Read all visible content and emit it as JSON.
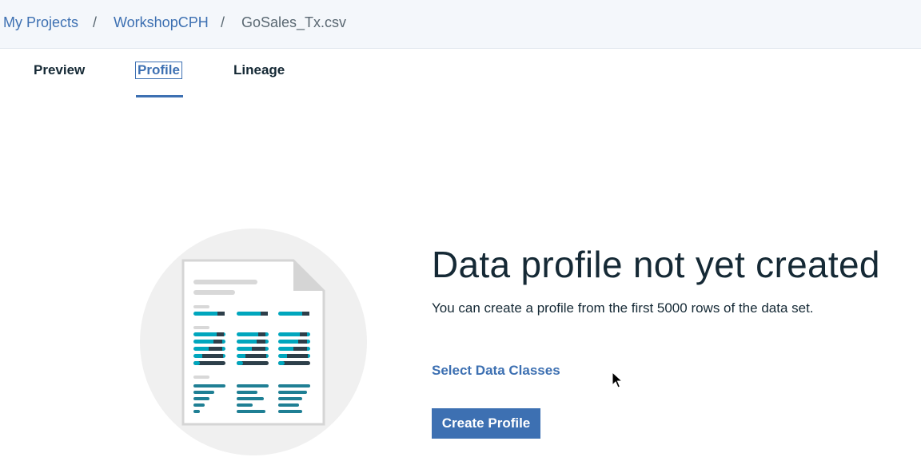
{
  "breadcrumb": {
    "items": [
      "My Projects",
      "WorkshopCPH",
      "GoSales_Tx.csv"
    ],
    "separator": "/"
  },
  "tabs": [
    {
      "label": "Preview",
      "active": false
    },
    {
      "label": "Profile",
      "active": true
    },
    {
      "label": "Lineage",
      "active": false
    }
  ],
  "empty_state": {
    "title": "Data profile not yet created",
    "description": "You can create a profile from the first 5000 rows of the data set.",
    "select_link": "Select Data Classes",
    "create_button": "Create Profile",
    "illustration_icon": "document-table-icon"
  },
  "colors": {
    "accent": "#3d70b2",
    "topbar_bg": "#f4f7fb",
    "teal": "#00a6bd",
    "dark_teal": "#1f7f94",
    "dark": "#2d3f4a"
  }
}
